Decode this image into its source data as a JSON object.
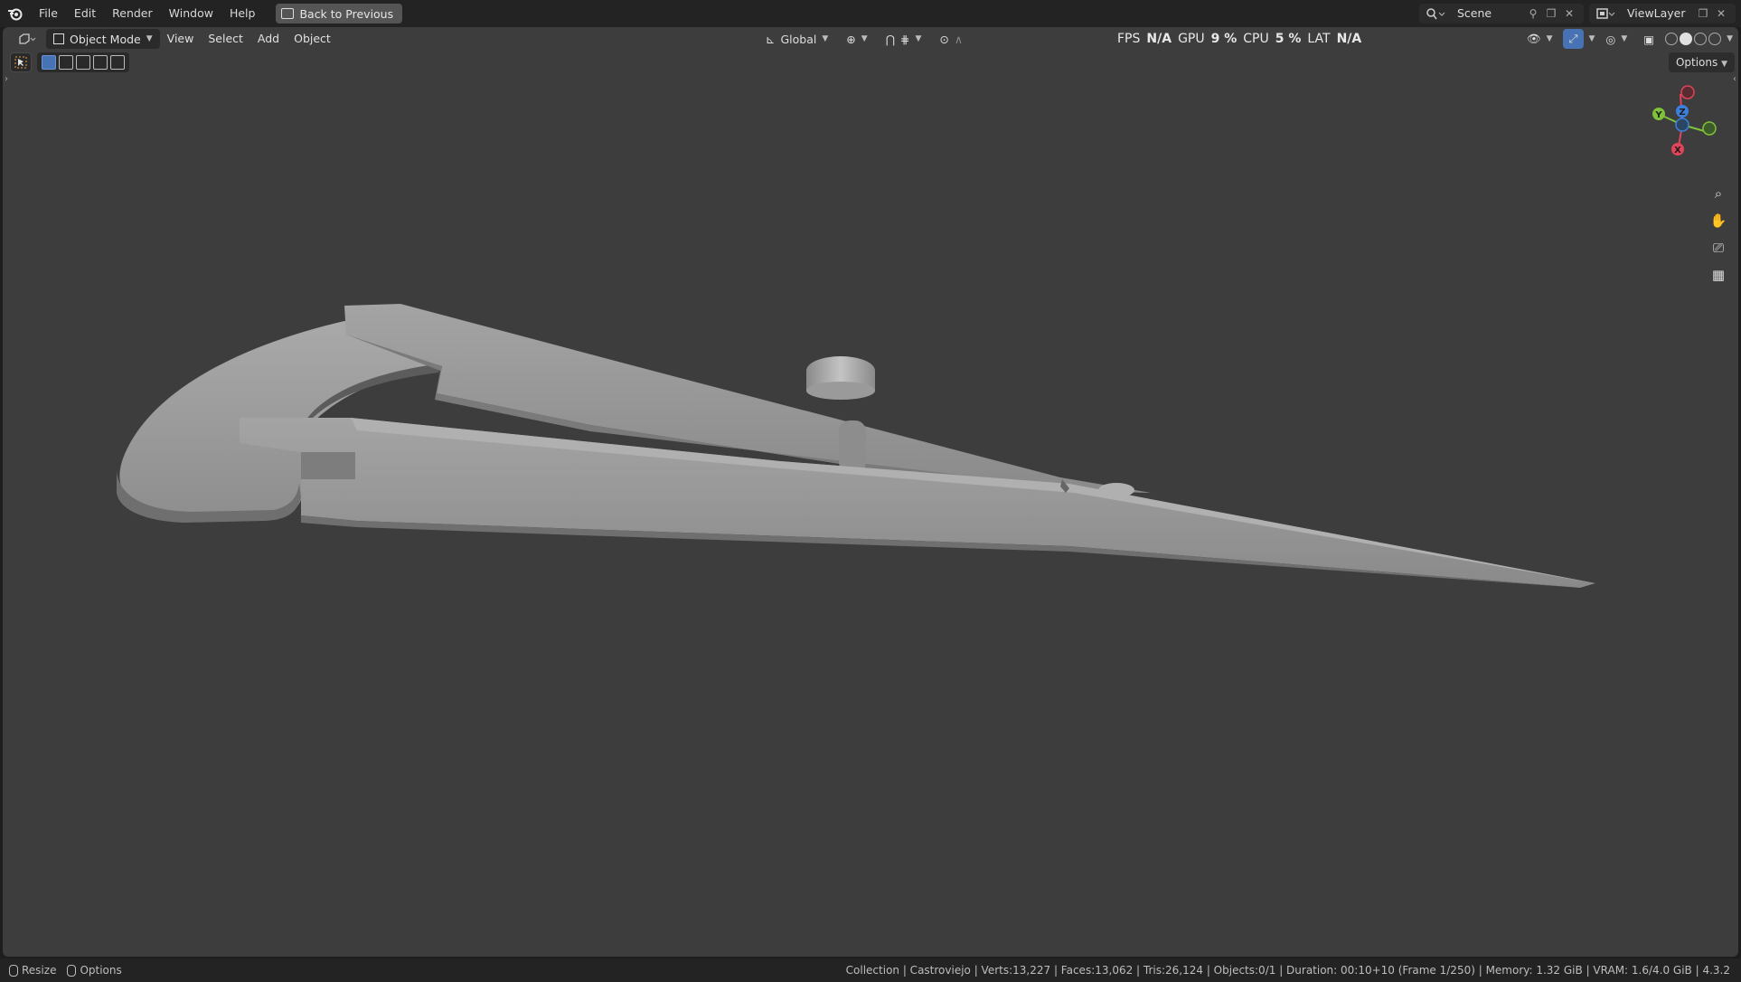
{
  "topbar": {
    "menu": [
      "File",
      "Edit",
      "Render",
      "Window",
      "Help"
    ],
    "back_button": "Back to Previous",
    "scene_label": "Scene",
    "view_layer_label": "ViewLayer"
  },
  "viewport_header": {
    "mode": "Object Mode",
    "menus": [
      "View",
      "Select",
      "Add",
      "Object"
    ],
    "transform_orientation": "Global",
    "options_label": "Options"
  },
  "overlay_stats": {
    "fps_label": "FPS",
    "fps_value": "N/A",
    "gpu_label": "GPU",
    "gpu_value": "9 %",
    "cpu_label": "CPU",
    "cpu_value": "5 %",
    "lat_label": "LAT",
    "lat_value": "N/A"
  },
  "gizmo": {
    "x_label": "X",
    "y_label": "Y",
    "z_label": "Z"
  },
  "statusbar": {
    "left": [
      "Resize",
      "Options"
    ],
    "info": "Collection | Castroviejo | Verts:13,227 | Faces:13,062 | Tris:26,124 | Objects:0/1 | Duration: 00:10+10 (Frame 1/250) | Memory: 1.32 GiB | VRAM: 1.6/4.0 GiB | 4.3.2"
  },
  "colors": {
    "viewport_bg": "#3d3d3d",
    "axis_x": "#e0455a",
    "axis_y": "#7fc23a",
    "axis_z": "#3d7fdc",
    "model": "#9a9a9a"
  }
}
